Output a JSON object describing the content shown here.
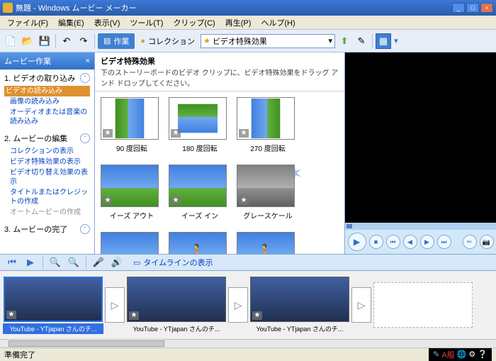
{
  "titlebar": {
    "text": "無題 - Windows ムービー メーカー"
  },
  "menu": {
    "file": "ファイル(F)",
    "edit": "編集(E)",
    "view": "表示(V)",
    "tool": "ツール(T)",
    "clip": "クリップ(C)",
    "play": "再生(P)",
    "help": "ヘルプ(H)"
  },
  "toolbar": {
    "tasks": "作業",
    "collection": "コレクション",
    "combo_value": "ビデオ特殊効果"
  },
  "sidebar": {
    "title": "ムービー作業",
    "sec1": {
      "title": "1. ビデオの取り込み",
      "i1": "ビデオの読み込み",
      "i2": "画像の読み込み",
      "i3": "オーディオまたは音楽の読み込み"
    },
    "sec2": {
      "title": "2. ムービーの編集",
      "i1": "コレクションの表示",
      "i2": "ビデオ特殊効果の表示",
      "i3": "ビデオ切り替え効果の表示",
      "i4": "タイトルまたはクレジットの作成",
      "i5": "オートムービーの作成"
    },
    "sec3": {
      "title": "3. ムービーの完了"
    }
  },
  "center": {
    "title": "ビデオ特殊効果",
    "subtitle": "下のストーリーボードのビデオ クリップに、ビデオ特殊効果をドラッグ アンド ドロップしてください。",
    "effects": {
      "e1": "90 度回転",
      "e2": "180 度回転",
      "e3": "270 度回転",
      "e4": "イーズ アウト",
      "e5": "イーズ イン",
      "e6": "グレースケール"
    }
  },
  "story": {
    "timeline_link": "タイムラインの表示",
    "clips": {
      "c1": "YouTube - YTjapan さんのチ...",
      "c2": "YouTube - YTjapan さんのチ...",
      "c3": "YouTube - YTjapan さんのチ..."
    }
  },
  "status": {
    "text": "準備完了",
    "ime": "A般"
  }
}
